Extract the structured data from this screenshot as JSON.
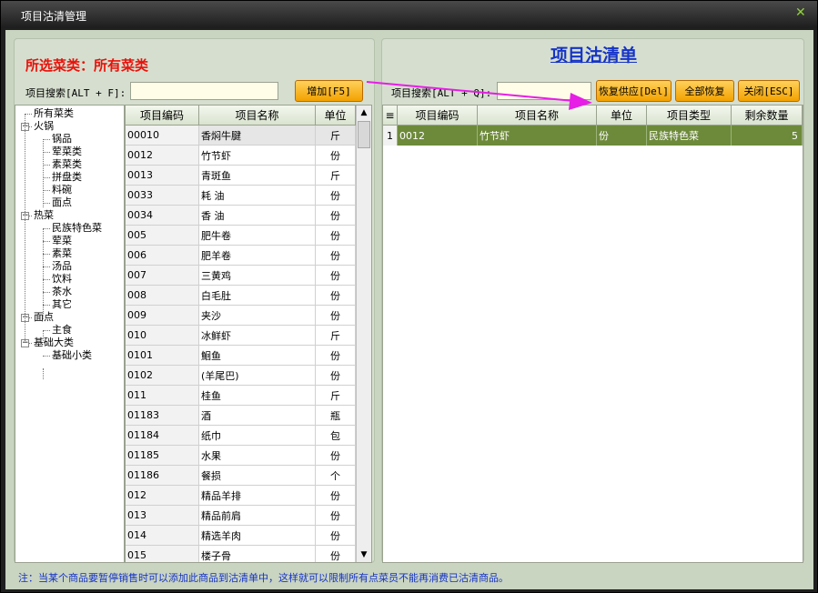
{
  "window": {
    "title": "项目沽清管理"
  },
  "left": {
    "selected_label": "所选菜类：所有菜类",
    "search_label": "项目搜索[ALT + F]:",
    "search_value": "",
    "add_button": "增加[F5]",
    "tree": [
      {
        "label": "所有菜类",
        "level": 0,
        "box": ""
      },
      {
        "label": "火锅",
        "level": 0,
        "box": "−"
      },
      {
        "label": "锅品",
        "level": 1,
        "box": ""
      },
      {
        "label": "荤菜类",
        "level": 1,
        "box": ""
      },
      {
        "label": "素菜类",
        "level": 1,
        "box": ""
      },
      {
        "label": "拼盘类",
        "level": 1,
        "box": ""
      },
      {
        "label": "料碗",
        "level": 1,
        "box": ""
      },
      {
        "label": "面点",
        "level": 1,
        "box": ""
      },
      {
        "label": "热菜",
        "level": 0,
        "box": "−"
      },
      {
        "label": "民族特色菜",
        "level": 1,
        "box": ""
      },
      {
        "label": "荤菜",
        "level": 1,
        "box": ""
      },
      {
        "label": "素菜",
        "level": 1,
        "box": ""
      },
      {
        "label": "汤品",
        "level": 1,
        "box": ""
      },
      {
        "label": "饮料",
        "level": 1,
        "box": ""
      },
      {
        "label": "茶水",
        "level": 1,
        "box": ""
      },
      {
        "label": "其它",
        "level": 1,
        "box": ""
      },
      {
        "label": "面点",
        "level": 0,
        "box": "−"
      },
      {
        "label": "主食",
        "level": 1,
        "box": ""
      },
      {
        "label": "基础大类",
        "level": 0,
        "box": "−"
      },
      {
        "label": "基础小类",
        "level": 1,
        "box": ""
      }
    ],
    "columns": [
      "项目编码",
      "项目名称",
      "单位"
    ],
    "rows": [
      [
        "00010",
        "香焖牛腱",
        "斤"
      ],
      [
        "0012",
        "竹节虾",
        "份"
      ],
      [
        "0013",
        "青斑鱼",
        "斤"
      ],
      [
        "0033",
        "耗 油",
        "份"
      ],
      [
        "0034",
        "香 油",
        "份"
      ],
      [
        "005",
        "肥牛卷",
        "份"
      ],
      [
        "006",
        "肥羊卷",
        "份"
      ],
      [
        "007",
        "三黄鸡",
        "份"
      ],
      [
        "008",
        "白毛肚",
        "份"
      ],
      [
        "009",
        "夹沙",
        "份"
      ],
      [
        "010",
        "冰鲜虾",
        "斤"
      ],
      [
        "0101",
        "鮰鱼",
        "份"
      ],
      [
        "0102",
        "(羊尾巴)",
        "份"
      ],
      [
        "011",
        "桂鱼",
        "斤"
      ],
      [
        "01183",
        "酒",
        "瓶"
      ],
      [
        "01184",
        "纸巾",
        "包"
      ],
      [
        "01185",
        "水果",
        "份"
      ],
      [
        "01186",
        "餐损",
        "个"
      ],
      [
        "012",
        "精品羊排",
        "份"
      ],
      [
        "013",
        "精品前肩",
        "份"
      ],
      [
        "014",
        "精选羊肉",
        "份"
      ],
      [
        "015",
        "楼子骨",
        "份"
      ]
    ]
  },
  "right": {
    "title": "项目沽清单",
    "search_label": "项目搜索[ALT + Q]:",
    "search_value": "",
    "restore_button": "恢复供应[Del]",
    "restore_all_button": "全部恢复",
    "close_button": "关闭[ESC]",
    "menu_glyph": "≡",
    "columns": [
      "项目编码",
      "项目名称",
      "单位",
      "项目类型",
      "剩余数量"
    ],
    "rows": [
      {
        "index": "1",
        "code": "0012",
        "name": "竹节虾",
        "unit": "份",
        "type": "民族特色菜",
        "remaining": "5"
      }
    ]
  },
  "footer": {
    "note": "注：当某个商品要暂停销售时可以添加此商品到沽清单中，这样就可以限制所有点菜员不能再消费已沽清商品。"
  },
  "colors": {
    "accent_red": "#e8120b",
    "title_blue": "#1533c8",
    "selected_row": "#6d8a3a",
    "button_orange": "#f3a100",
    "arrow_magenta": "#e61ee6"
  }
}
